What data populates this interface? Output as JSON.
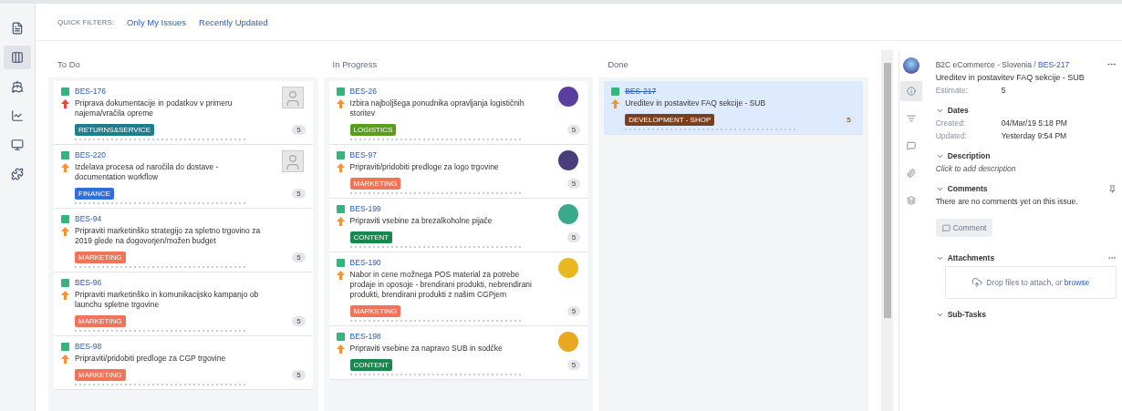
{
  "sidebar": {
    "items": [
      {
        "selected": false
      },
      {
        "selected": true
      },
      {
        "selected": false
      },
      {
        "selected": false
      },
      {
        "selected": false
      },
      {
        "selected": false
      }
    ]
  },
  "quick_filters": {
    "label": "QUICK FILTERS:",
    "items": [
      "Only My Issues",
      "Recently Updated"
    ]
  },
  "columns": [
    {
      "title": "To Do",
      "cards": [
        {
          "key": "BES-176",
          "summary": "Priprava dokumentacije in podatkov v primeru najema/vračila opreme",
          "label": "RETURNS&SERVICE",
          "color": "#1d7f8c",
          "estimate": "5",
          "avatar": {
            "kind": "placeholder"
          },
          "priority": {
            "color": "#e5493a"
          },
          "selected": false,
          "done": false
        },
        {
          "key": "BES-220",
          "summary": "Izdelava procesa od naročila do dostave - documentation workflow",
          "label": "FINANCE",
          "color": "#2f6fdc",
          "estimate": "5",
          "avatar": {
            "kind": "placeholder"
          },
          "priority": {
            "color": "#f79232"
          },
          "selected": false,
          "done": false
        },
        {
          "key": "BES-94",
          "summary": "Pripraviti marketinško strategijo za spletno trgovino za 2019 glede na dogovorjen/možen budget",
          "label": "MARKETING",
          "color": "#f0735a",
          "estimate": "5",
          "priority": {
            "color": "#f79232"
          },
          "selected": false,
          "done": false
        },
        {
          "key": "BES-96",
          "summary": "Pripraviti marketinško in komunikacijsko kampanjo ob launchu spletne trgovine",
          "label": "MARKETING",
          "color": "#f0735a",
          "estimate": "5",
          "priority": {
            "color": "#f79232"
          },
          "selected": false,
          "done": false
        },
        {
          "key": "BES-98",
          "summary": "Pripraviti/pridobiti predloge za CGP trgovine",
          "label": "MARKETING",
          "color": "#f0735a",
          "estimate": "5",
          "priority": {
            "color": "#f79232"
          },
          "selected": false,
          "done": false
        }
      ]
    },
    {
      "title": "In Progress",
      "cards": [
        {
          "key": "BES-26",
          "summary": "Izbira najboljšega ponudnika opravljanja logističnih storitev",
          "label": "LOGISTICS",
          "color": "#5a9e1f",
          "estimate": "5",
          "avatar": {
            "kind": "user",
            "color": "#5b3f9e"
          },
          "priority": {
            "color": "#f79232"
          },
          "selected": false,
          "done": false
        },
        {
          "key": "BES-97",
          "summary": "Pripraviti/pridobiti predloge za logo trgovine",
          "label": "MARKETING",
          "color": "#f0735a",
          "estimate": "5",
          "avatar": {
            "kind": "user",
            "color": "#4a3d7c"
          },
          "priority": {
            "color": "#f79232"
          },
          "selected": false,
          "done": false
        },
        {
          "key": "BES-199",
          "summary": "Pripraviti vsebine za brezalkoholne pijače",
          "label": "CONTENT",
          "color": "#168a4e",
          "estimate": "5",
          "avatar": {
            "kind": "user",
            "color": "#3aa88a"
          },
          "priority": {
            "color": "#f79232"
          },
          "selected": false,
          "done": false
        },
        {
          "key": "BES-190",
          "summary": "Nabor in cene možnega POS material za potrebe prodaje in oposoje - brendirani produkti, nebrendirani produkti, brendirani produkti z našim CGPjem",
          "label": "MARKETING",
          "color": "#f0735a",
          "estimate": "5",
          "avatar": {
            "kind": "user",
            "color": "#e8b820"
          },
          "priority": {
            "color": "#f79232"
          },
          "selected": false,
          "done": false
        },
        {
          "key": "BES-198",
          "summary": "Pripraviti vsebine za napravo SUB in sodčke",
          "label": "CONTENT",
          "color": "#168a4e",
          "estimate": "5",
          "avatar": {
            "kind": "user",
            "color": "#e8a820"
          },
          "priority": {
            "color": "#f79232"
          },
          "selected": false,
          "done": false
        }
      ]
    },
    {
      "title": "Done",
      "cards": [
        {
          "key": "BES-217",
          "summary": "Ureditev in postavitev FAQ sekcije - SUB",
          "label": "DEVELOPMENT - SHOP",
          "color": "#7a3f1a",
          "estimate": "5",
          "priority": {
            "color": "#f79232"
          },
          "selected": true,
          "done": true
        }
      ]
    }
  ],
  "detail": {
    "project": "B2C eCommerce - Slovenia",
    "separator": "/",
    "key": "BES-217",
    "title": "Ureditev in postavitev FAQ sekcije - SUB",
    "estimate_label": "Estimate:",
    "estimate_value": "5",
    "tabs": [
      {
        "selected": true
      },
      {
        "selected": false
      },
      {
        "selected": false
      },
      {
        "selected": false
      },
      {
        "selected": false
      }
    ],
    "sections": [
      {
        "kind": "fields",
        "title": "Dates",
        "rows": [
          {
            "label": "Created:",
            "value": "04/Mar/19 5:18 PM"
          },
          {
            "label": "Updated:",
            "value": "Yesterday 9:54 PM"
          }
        ]
      },
      {
        "kind": "placeholder",
        "title": "Description",
        "text": "Click to add description"
      },
      {
        "kind": "comments",
        "title": "Comments",
        "text": "There are no comments yet on this issue.",
        "button": "Comment"
      },
      {
        "kind": "attachments",
        "title": "Attachments",
        "text": "Drop files to attach, or",
        "link": "browse"
      },
      {
        "kind": "empty",
        "title": "Sub-Tasks"
      }
    ]
  }
}
